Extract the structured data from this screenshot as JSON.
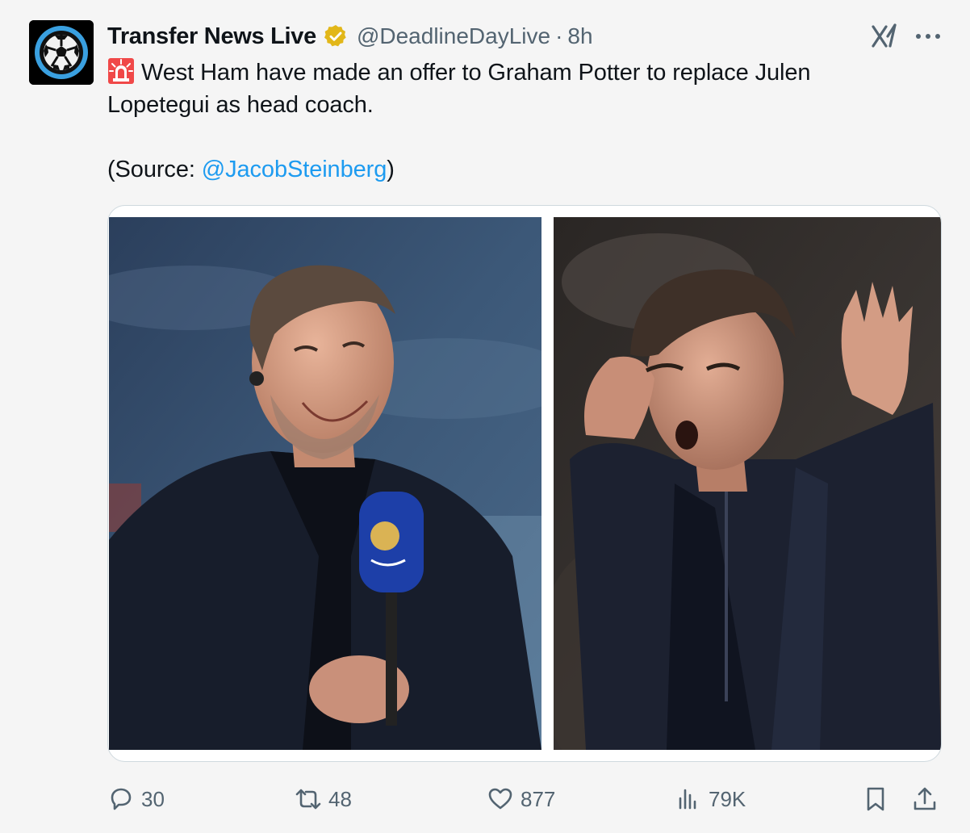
{
  "tweet": {
    "author": {
      "display_name": "Transfer News Live",
      "handle": "@DeadlineDayLive",
      "separator": "·",
      "time": "8h",
      "verified": true,
      "verified_color": "#e2b719"
    },
    "text": {
      "line1": "West Ham have made an offer to Graham Potter to replace Julen Lopetegui as head coach.",
      "source_prefix": "(Source: ",
      "source_mention": "@JacobSteinberg",
      "source_suffix": ")"
    },
    "icons": {
      "siren": "rotating-light-emoji",
      "grok": "grok-icon",
      "more": "more-icon"
    },
    "actions": {
      "replies": "30",
      "reposts": "48",
      "likes": "877",
      "views": "79K"
    },
    "colors": {
      "link": "#1d9bf0",
      "secondary_text": "#536471",
      "primary_text": "#0f1419"
    }
  }
}
